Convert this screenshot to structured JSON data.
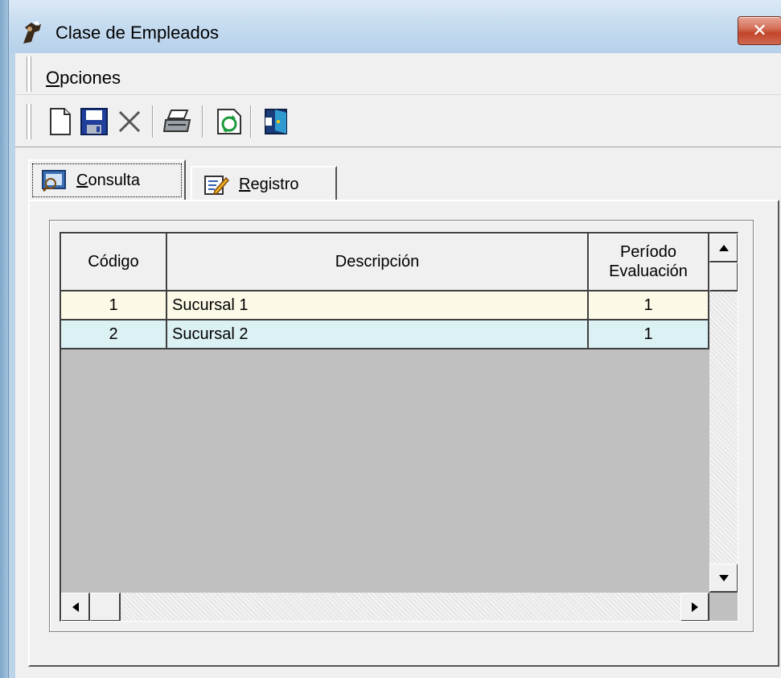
{
  "window": {
    "title": "Clase de Empleados",
    "close_label": "✕"
  },
  "menu": {
    "items": [
      {
        "mnemonic": "O",
        "rest": "pciones"
      }
    ]
  },
  "toolbar": {
    "buttons": [
      "new-document-icon",
      "save-icon",
      "delete-icon",
      "print-icon",
      "refresh-icon",
      "exit-icon"
    ]
  },
  "tabs": [
    {
      "mnemonic": "C",
      "rest": "onsulta",
      "active": true,
      "icon": "query-icon"
    },
    {
      "mnemonic": "R",
      "rest": "egistro",
      "active": false,
      "icon": "edit-icon"
    }
  ],
  "grid": {
    "columns": [
      {
        "label": "Código"
      },
      {
        "label": "Descripción"
      },
      {
        "label": "Período Evaluación"
      }
    ],
    "rows": [
      {
        "codigo": "1",
        "descripcion": "Sucursal 1",
        "periodo": "1",
        "color": "#fcfae6"
      },
      {
        "codigo": "2",
        "descripcion": "Sucursal 2",
        "periodo": "1",
        "color": "#dbf1f4"
      }
    ]
  },
  "colors": {
    "close_button": "#c8513a",
    "grid_background": "#c0c0c0",
    "row1": "#fcfae6",
    "row2": "#dbf1f4"
  }
}
